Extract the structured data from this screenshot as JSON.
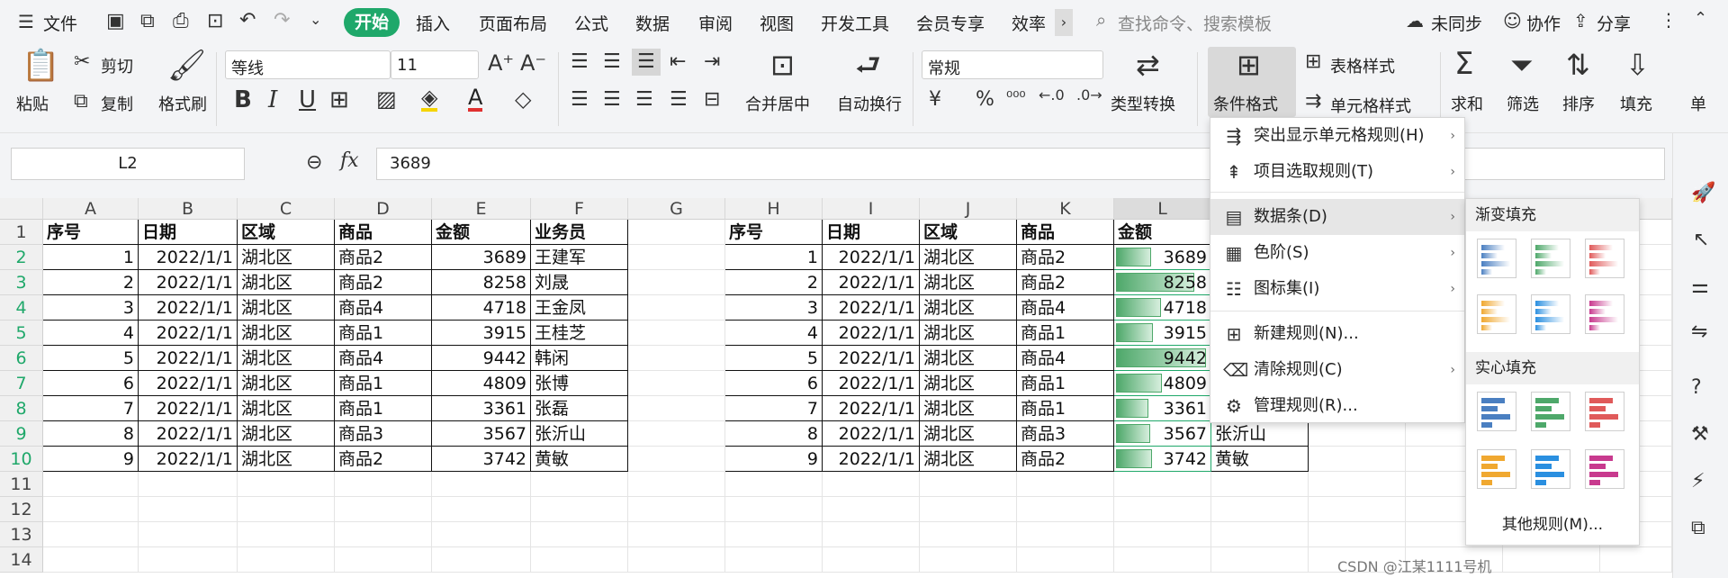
{
  "tabs": {
    "menu_file": "文件",
    "active": "开始",
    "items": [
      "插入",
      "页面布局",
      "公式",
      "数据",
      "审阅",
      "视图",
      "开发工具",
      "会员专享",
      "效率"
    ],
    "search_placeholder": "查找命令、搜索模板",
    "sync": "未同步",
    "collab": "协作",
    "share": "分享"
  },
  "ribbon": {
    "paste": "粘贴",
    "cut": "剪切",
    "copy": "复制",
    "format_painter": "格式刷",
    "font_name": "等线",
    "font_size": "11",
    "merge": "合并居中",
    "wrap": "自动换行",
    "number_format": "常规",
    "type_convert": "类型转换",
    "cond_format": "条件格式",
    "table_style": "表格样式",
    "cell_style": "单元格样式",
    "sum": "求和",
    "filter": "筛选",
    "sort": "排序",
    "fill": "填充",
    "more": "单"
  },
  "formula_bar": {
    "name_box": "L2",
    "fx": "fx",
    "value": "3689"
  },
  "columns": [
    "A",
    "B",
    "C",
    "D",
    "E",
    "F",
    "G",
    "H",
    "I",
    "J",
    "K",
    "L"
  ],
  "rows": [
    "1",
    "2",
    "3",
    "4",
    "5",
    "6",
    "7",
    "8",
    "9",
    "10",
    "11",
    "12",
    "13",
    "14"
  ],
  "headers": [
    "序号",
    "日期",
    "区域",
    "商品",
    "金额",
    "业务员"
  ],
  "table": [
    [
      "1",
      "2022/1/1",
      "湖北区",
      "商品2",
      "3689",
      "王建军"
    ],
    [
      "2",
      "2022/1/1",
      "湖北区",
      "商品2",
      "8258",
      "刘晟"
    ],
    [
      "3",
      "2022/1/1",
      "湖北区",
      "商品4",
      "4718",
      "王金凤"
    ],
    [
      "4",
      "2022/1/1",
      "湖北区",
      "商品1",
      "3915",
      "王桂芝"
    ],
    [
      "5",
      "2022/1/1",
      "湖北区",
      "商品4",
      "9442",
      "韩闲"
    ],
    [
      "6",
      "2022/1/1",
      "湖北区",
      "商品1",
      "4809",
      "张博"
    ],
    [
      "7",
      "2022/1/1",
      "湖北区",
      "商品1",
      "3361",
      "张磊"
    ],
    [
      "8",
      "2022/1/1",
      "湖北区",
      "商品3",
      "3567",
      "张沂山"
    ],
    [
      "9",
      "2022/1/1",
      "湖北区",
      "商品2",
      "3742",
      "黄敏"
    ]
  ],
  "right_headers": [
    "序号",
    "日期",
    "区域",
    "商品",
    "金额"
  ],
  "right_tail": [
    "张沂山",
    "黄敏"
  ],
  "menu": {
    "items": [
      "突出显示单元格规则(H)",
      "项目选取规则(T)",
      "数据条(D)",
      "色阶(S)",
      "图标集(I)",
      "新建规则(N)...",
      "清除规则(C)",
      "管理规则(R)..."
    ]
  },
  "submenu": {
    "gradient": "渐变填充",
    "solid": "实心填充",
    "other": "其他规则(M)...",
    "colors": [
      "#4a7fc1",
      "#4ea86a",
      "#e05a5a",
      "#f0a830",
      "#2a8fe0",
      "#c83a8e"
    ]
  },
  "watermark": "CSDN @江某1111号机"
}
